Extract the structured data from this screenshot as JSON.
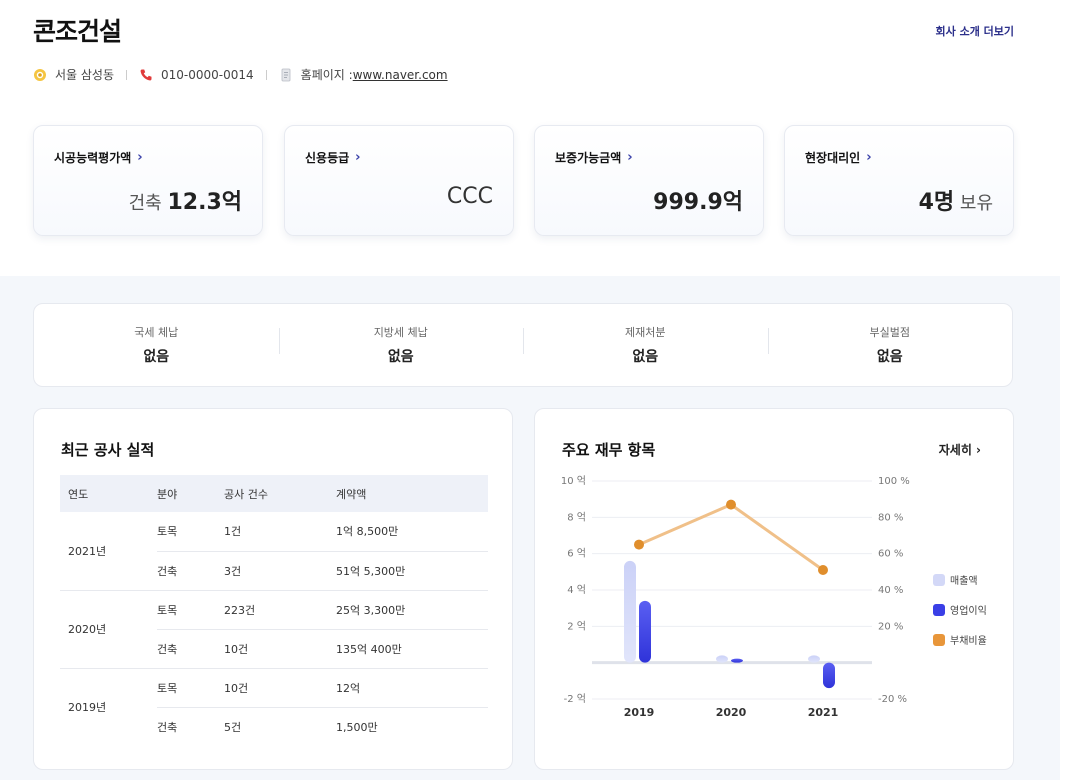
{
  "header": {
    "company_name": "콘조건설",
    "more_link": "회사 소개 더보기",
    "location": "서울 삼성동",
    "phone": "010-0000-0014",
    "homepage_label": "홈페이지 : ",
    "homepage_url": "www.naver.com"
  },
  "cards": [
    {
      "title": "시공능력평가액",
      "prefix": "건축 ",
      "value": "12.3억",
      "suffix": ""
    },
    {
      "title": "신용등급",
      "prefix": "",
      "value": "CCC",
      "suffix": ""
    },
    {
      "title": "보증가능금액",
      "prefix": "",
      "value": "999.9억",
      "suffix": ""
    },
    {
      "title": "현장대리인",
      "prefix": "",
      "value": "4명",
      "suffix": " 보유"
    }
  ],
  "status": [
    {
      "label": "국세 체납",
      "value": "없음"
    },
    {
      "label": "지방세 체납",
      "value": "없음"
    },
    {
      "label": "제재처분",
      "value": "없음"
    },
    {
      "label": "부실벌점",
      "value": "없음"
    }
  ],
  "records": {
    "title": "최근 공사 실적",
    "columns": [
      "연도",
      "분야",
      "공사 건수",
      "계약액"
    ],
    "groups": [
      {
        "year": "2021년",
        "rows": [
          [
            "토목",
            "1건",
            "1억 8,500만"
          ],
          [
            "건축",
            "3건",
            "51억 5,300만"
          ]
        ]
      },
      {
        "year": "2020년",
        "rows": [
          [
            "토목",
            "223건",
            "25억 3,300만"
          ],
          [
            "건축",
            "10건",
            "135억 400만"
          ]
        ]
      },
      {
        "year": "2019년",
        "rows": [
          [
            "토목",
            "10건",
            "12억"
          ],
          [
            "건축",
            "5건",
            "1,500만"
          ]
        ]
      }
    ]
  },
  "finance": {
    "title": "주요 재무 항목",
    "detail_link": "자세히",
    "chevron": "chevron-right-icon"
  },
  "chart_data": {
    "type": "bar",
    "categories": [
      "2019",
      "2020",
      "2021"
    ],
    "series": [
      {
        "name": "매출액",
        "kind": "bar",
        "axis": "left",
        "values": [
          5.6,
          0.4,
          0.4
        ],
        "color": "#d3d8f7"
      },
      {
        "name": "영업이익",
        "kind": "bar",
        "axis": "left",
        "values": [
          3.4,
          0.2,
          -1.4
        ],
        "color": "#3a3fe6"
      },
      {
        "name": "부채비율",
        "kind": "line",
        "axis": "right",
        "values": [
          65,
          87,
          51
        ],
        "color": "#e8963a"
      }
    ],
    "left_axis": {
      "ticks": [
        "10 억",
        "8 억",
        "6 억",
        "4 억",
        "2 억",
        "-2 억"
      ],
      "values": [
        10,
        8,
        6,
        4,
        2,
        -2
      ],
      "ylim": [
        -2,
        10
      ]
    },
    "right_axis": {
      "ticks": [
        "100 %",
        "80 %",
        "60 %",
        "40 %",
        "20 %",
        "-20 %"
      ],
      "values": [
        100,
        80,
        60,
        40,
        20,
        -20
      ],
      "ylim": [
        -20,
        100
      ]
    },
    "legend_position": "right",
    "grid": true
  }
}
